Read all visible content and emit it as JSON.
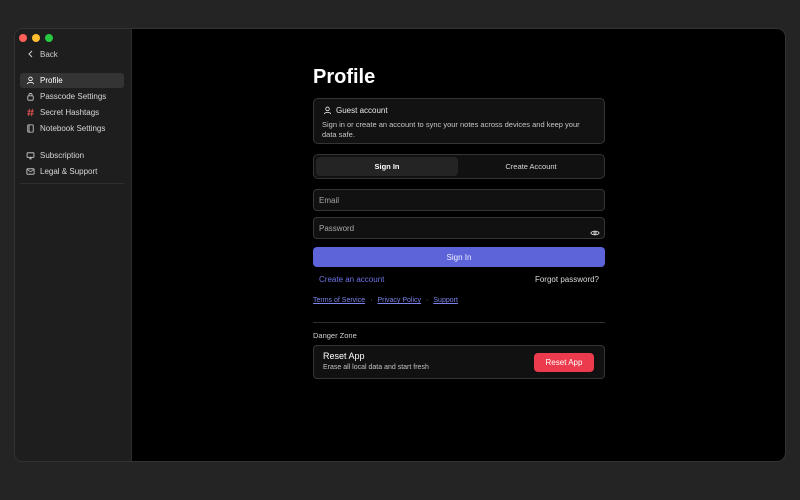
{
  "window": {
    "controls": [
      "close",
      "minimize",
      "maximize"
    ],
    "colors": {
      "close": "#ff5f57",
      "minimize": "#febc2e",
      "maximize": "#28c840"
    }
  },
  "sidebar": {
    "back_label": "Back",
    "items": [
      {
        "label": "Profile",
        "icon": "user-icon",
        "active": true
      },
      {
        "label": "Passcode Settings",
        "icon": "lock-icon",
        "active": false
      },
      {
        "label": "Secret Hashtags",
        "icon": "hashtag-icon",
        "active": false
      },
      {
        "label": "Notebook Settings",
        "icon": "notebook-icon",
        "active": false
      },
      {
        "label": "Subscription",
        "icon": "subscription-icon",
        "active": false
      },
      {
        "label": "Legal & Support",
        "icon": "mail-icon",
        "active": false
      }
    ]
  },
  "profile": {
    "title": "Profile",
    "guest": {
      "heading": "Guest account",
      "text": "Sign in or create an account to sync your notes across devices and keep your data safe.",
      "icon": "user-icon"
    },
    "tabs": [
      {
        "label": "Sign In",
        "active": true
      },
      {
        "label": "Create Account",
        "active": false
      }
    ],
    "fields": {
      "email_placeholder": "Email",
      "password_placeholder": "Password",
      "email_value": "",
      "password_value": ""
    },
    "sign_in_button": "Sign In",
    "create_account_link": "Create an account",
    "forgot_password_link": "Forgot password?",
    "legal_links": {
      "terms": "Terms of Service",
      "privacy": "Privacy Policy",
      "support": "Support",
      "separator": "·"
    },
    "danger_zone": {
      "title": "Danger Zone",
      "heading": "Reset App",
      "description": "Erase all local data and start fresh",
      "button": "Reset App"
    }
  },
  "colors": {
    "accent": "#5d63d9",
    "danger": "#ec3b4c",
    "background": "#000000",
    "sidebar": "#1e1e1e"
  }
}
